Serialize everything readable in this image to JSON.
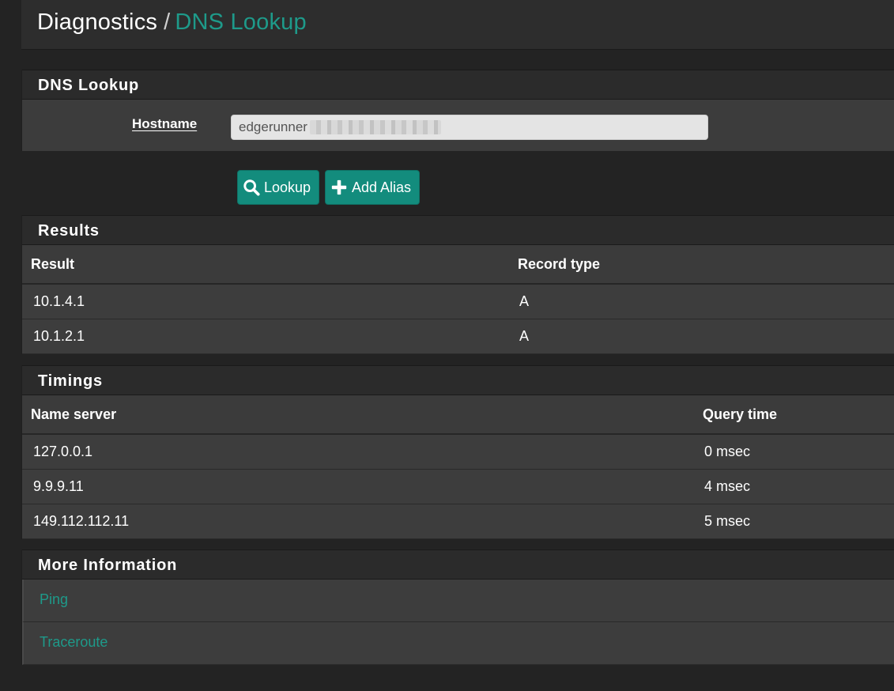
{
  "breadcrumb": {
    "section": "Diagnostics",
    "separator": "/",
    "page": "DNS Lookup"
  },
  "lookup_panel": {
    "title": "DNS Lookup",
    "hostname_label": "Hostname",
    "hostname_value": "edgerunner"
  },
  "buttons": {
    "lookup": "Lookup",
    "add_alias": "Add Alias"
  },
  "results": {
    "title": "Results",
    "columns": [
      "Result",
      "Record type"
    ],
    "rows": [
      {
        "result": "10.1.4.1",
        "type": "A"
      },
      {
        "result": "10.1.2.1",
        "type": "A"
      }
    ]
  },
  "timings": {
    "title": "Timings",
    "columns": [
      "Name server",
      "Query time"
    ],
    "rows": [
      {
        "server": "127.0.0.1",
        "time": "0 msec"
      },
      {
        "server": "9.9.9.11",
        "time": "4 msec"
      },
      {
        "server": "149.112.112.11",
        "time": "5 msec"
      }
    ]
  },
  "more_info": {
    "title": "More Information",
    "links": [
      "Ping",
      "Traceroute"
    ]
  },
  "colors": {
    "accent": "#1e9a8a",
    "button": "#138c7d",
    "background": "#232323",
    "panel": "#3a3a3a",
    "heading": "#2b2b2b"
  },
  "icons": {
    "lookup": "search-icon",
    "add_alias": "plus-icon"
  }
}
